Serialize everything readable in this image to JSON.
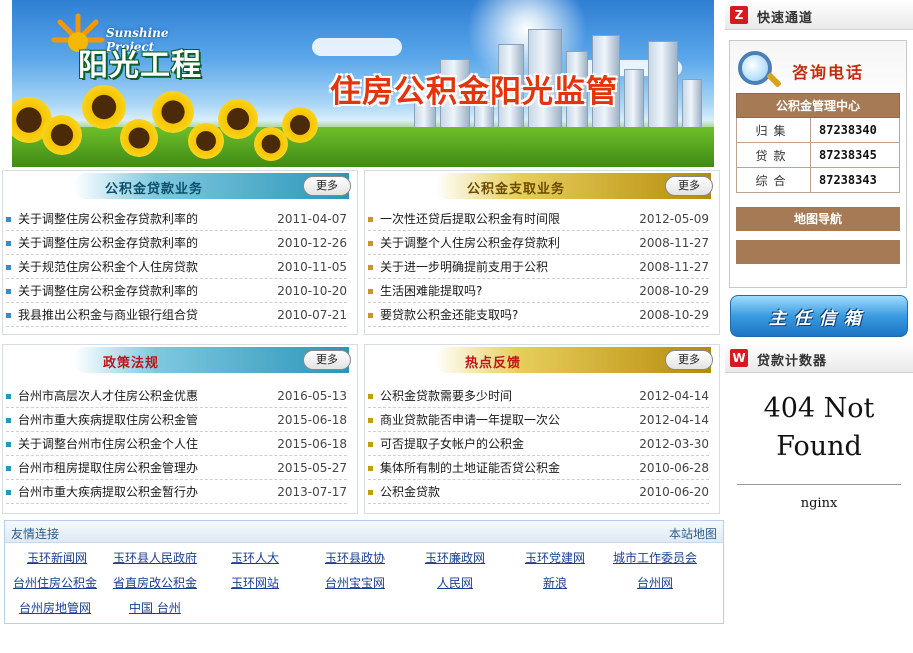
{
  "banner": {
    "logo_en": "Sunshine Project",
    "logo_cn": "阳光工程",
    "title": "住房公积金阳光监管"
  },
  "panels": {
    "loans": {
      "title": "公积金贷款业务",
      "more": "更多",
      "items": [
        {
          "title": "关于调整住房公积金存贷款利率的",
          "date": "2011-04-07"
        },
        {
          "title": "关于调整住房公积金存贷款利率的",
          "date": "2010-12-26"
        },
        {
          "title": "关于规范住房公积金个人住房贷款",
          "date": "2010-11-05"
        },
        {
          "title": "关于调整住房公积金存贷款利率的",
          "date": "2010-10-20"
        },
        {
          "title": "我县推出公积金与商业银行组合贷",
          "date": "2010-07-21"
        }
      ]
    },
    "withdraw": {
      "title": "公积金支取业务",
      "more": "更多",
      "items": [
        {
          "title": "一次性还贷后提取公积金有时间限",
          "date": "2012-05-09"
        },
        {
          "title": "关于调整个人住房公积金存贷款利",
          "date": "2008-11-27"
        },
        {
          "title": "关于进一步明确提前支用于公积",
          "date": "2008-11-27"
        },
        {
          "title": "生活困难能提取吗?",
          "date": "2008-10-29"
        },
        {
          "title": "要贷款公积金还能支取吗?",
          "date": "2008-10-29"
        }
      ]
    },
    "policy": {
      "title": "政策法规",
      "more": "更多",
      "items": [
        {
          "title": "台州市高层次人才住房公积金优惠",
          "date": "2016-05-13"
        },
        {
          "title": "台州市重大疾病提取住房公积金管",
          "date": "2015-06-18"
        },
        {
          "title": "关于调整台州市住房公积金个人住",
          "date": "2015-06-18"
        },
        {
          "title": "台州市租房提取住房公积金管理办",
          "date": "2015-05-27"
        },
        {
          "title": "台州市重大疾病提取公积金暂行办",
          "date": "2013-07-17"
        }
      ]
    },
    "hot": {
      "title": "热点反馈",
      "more": "更多",
      "items": [
        {
          "title": "公积金贷款需要多少时间",
          "date": "2012-04-14"
        },
        {
          "title": "商业贷款能否申请一年提取一次公",
          "date": "2012-04-14"
        },
        {
          "title": "可否提取子女帐户的公积金",
          "date": "2012-03-30"
        },
        {
          "title": "集体所有制的土地证能否贷公积金",
          "date": "2010-06-28"
        },
        {
          "title": "公积金贷款",
          "date": "2010-06-20"
        }
      ]
    }
  },
  "links": {
    "title": "友情连接",
    "sitemap": "本站地图",
    "items": [
      "玉环新闻网",
      "玉环县人民政府",
      "玉环人大",
      "玉环县政协",
      "玉环廉政网",
      "玉环党建网",
      "城市工作委员会",
      "台州住房公积金",
      "省直房改公积金",
      "玉环网站",
      "台州宝宝网",
      "人民网",
      "新浪",
      "台州网",
      "台州房地管网",
      "中国 台州"
    ]
  },
  "sidebar": {
    "quick_access": {
      "icon": "Z",
      "label": "快速通道"
    },
    "consult": {
      "title": "咨询电话",
      "center": "公积金管理中心",
      "phones": [
        {
          "label": "归集",
          "number": "87238340"
        },
        {
          "label": "贷款",
          "number": "87238345"
        },
        {
          "label": "综合",
          "number": "87238343"
        }
      ],
      "map_nav": "地图导航"
    },
    "mailbox": "主任信箱",
    "loan_calc": {
      "icon": "W",
      "label": "贷款计数器"
    },
    "error_page": {
      "title": "404 Not Found",
      "server": "nginx"
    }
  },
  "colors": {
    "banner_title": "#e4330d",
    "blue_tab": "#2b95b8",
    "gold_tab": "#b58a0a",
    "side_icon": "#d71920",
    "phone_header": "#a67a55",
    "link": "#1b3f8f"
  }
}
